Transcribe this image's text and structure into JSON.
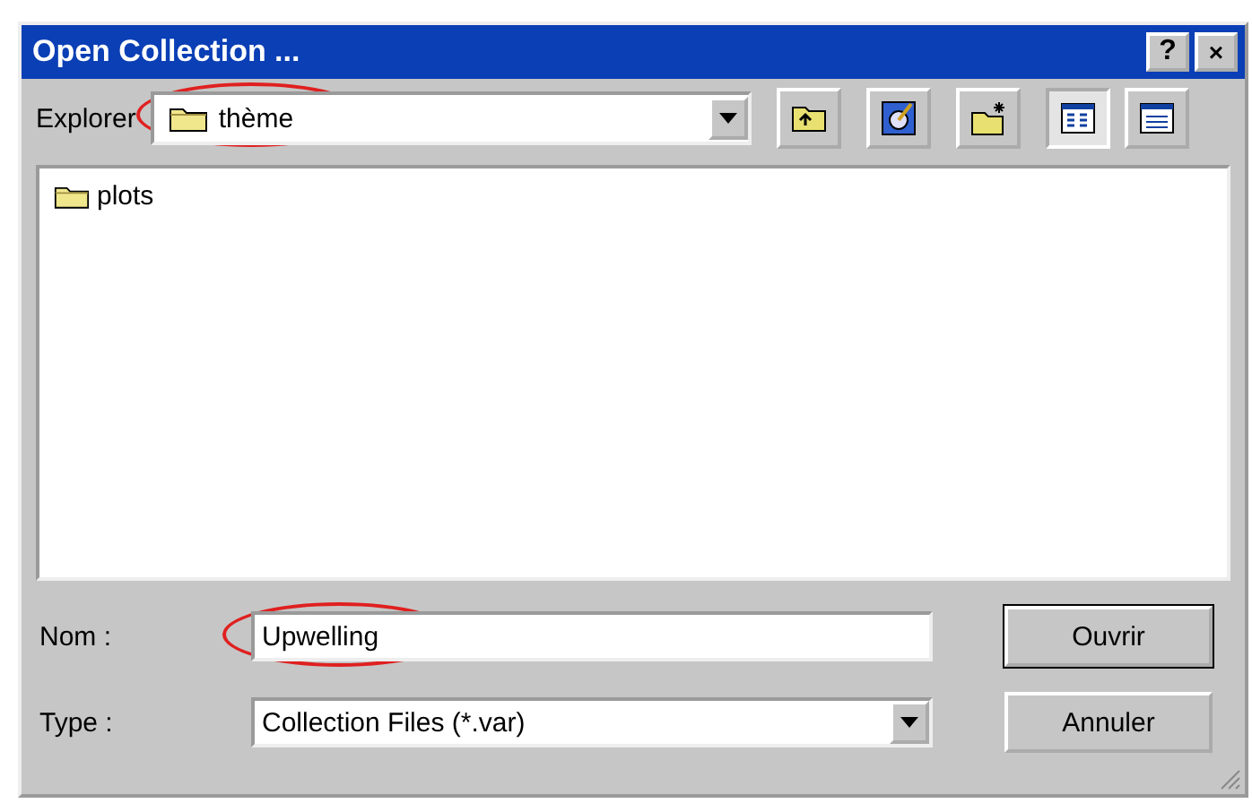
{
  "window": {
    "title": "Open Collection ...",
    "controls": [
      {
        "kind": "help",
        "label": "?"
      },
      {
        "kind": "close",
        "label": "×"
      }
    ]
  },
  "location": {
    "label": "Explorer",
    "value": "thème",
    "circled": true
  },
  "toolbar": [
    {
      "kind": "up",
      "selected": false
    },
    {
      "kind": "desktop",
      "selected": false
    },
    {
      "kind": "new-folder",
      "selected": false
    },
    {
      "kind": "list",
      "selected": true
    },
    {
      "kind": "details",
      "selected": false
    }
  ],
  "files": [
    {
      "name": "plots",
      "selected": false
    }
  ],
  "filename": {
    "label": "Nom :",
    "value": "Upwelling",
    "circled": true
  },
  "filetype": {
    "label": "Type :",
    "value": "Collection Files (*.var)"
  },
  "buttons": [
    {
      "label": "Ouvrir",
      "default": true
    },
    {
      "label": "Annuler",
      "default": false
    }
  ]
}
